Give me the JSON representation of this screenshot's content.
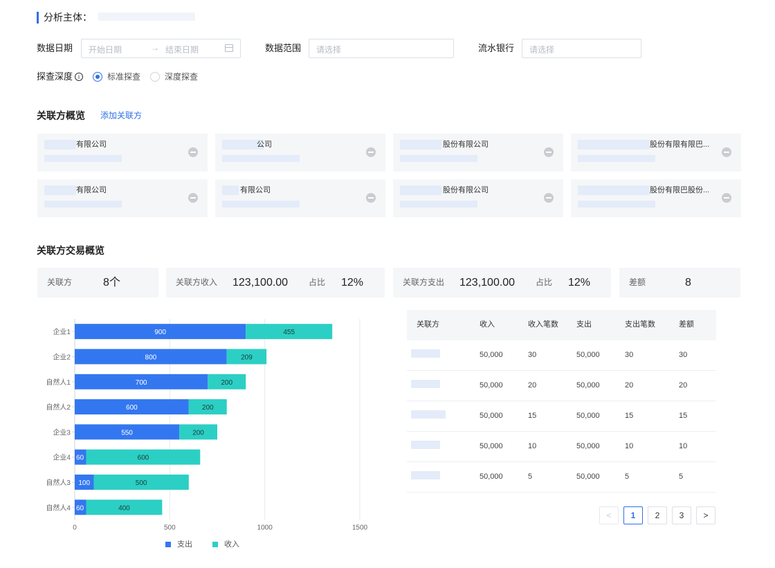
{
  "header": {
    "title": "分析主体："
  },
  "filters": {
    "date_label": "数据日期",
    "start_placeholder": "开始日期",
    "end_placeholder": "结束日期",
    "range_label": "数据范围",
    "range_placeholder": "请选择",
    "bank_label": "流水银行",
    "bank_placeholder": "请选择",
    "depth_label": "探查深度",
    "depth_options": [
      "标准探查",
      "深度探查"
    ],
    "depth_selected": "标准探查"
  },
  "related_overview": {
    "title": "关联方概览",
    "add_link": "添加关联方",
    "cards": [
      {
        "name": "有限公司"
      },
      {
        "name": "公司"
      },
      {
        "name": "股份有限公司"
      },
      {
        "name": "股份有限有限巴..."
      },
      {
        "name": "有限公司"
      },
      {
        "name": "有限公司"
      },
      {
        "name": "股份有限公司"
      },
      {
        "name": "股份有限巴股份..."
      }
    ]
  },
  "transactions": {
    "title": "关联方交易概览",
    "summary": {
      "count_label": "关联方",
      "count_value": "8个",
      "income_label": "关联方收入",
      "income_value": "123,100.00",
      "income_ratio_label": "占比",
      "income_ratio_value": "12%",
      "expense_label": "关联方支出",
      "expense_value": "123,100.00",
      "expense_ratio_label": "占比",
      "expense_ratio_value": "12%",
      "diff_label": "差额",
      "diff_value": "8"
    }
  },
  "colors": {
    "accent": "#2f6fe8",
    "expense": "#3377f0",
    "income": "#2ccfc4"
  },
  "chart_data": {
    "type": "bar",
    "orientation": "horizontal",
    "stacked": true,
    "categories": [
      "企业1",
      "企业2",
      "自然人1",
      "自然人2",
      "企业3",
      "企业4",
      "自然人3",
      "自然人4"
    ],
    "series": [
      {
        "name": "支出",
        "color": "#3377f0",
        "values": [
          900,
          800,
          700,
          600,
          550,
          60,
          100,
          60
        ]
      },
      {
        "name": "收入",
        "color": "#2ccfc4",
        "values": [
          455,
          209,
          200,
          200,
          200,
          600,
          500,
          400
        ]
      }
    ],
    "xlim": [
      0,
      1500
    ],
    "xticks": [
      "0",
      "500",
      "1000",
      "1500"
    ],
    "grid": "vertical",
    "legend": "bottom"
  },
  "table": {
    "columns": [
      "关联方",
      "收入",
      "收入笔数",
      "支出",
      "支出笔数",
      "差额"
    ],
    "rows": [
      {
        "income": "50,000",
        "income_count": "30",
        "expense": "50,000",
        "expense_count": "30",
        "diff": "30"
      },
      {
        "income": "50,000",
        "income_count": "20",
        "expense": "50,000",
        "expense_count": "20",
        "diff": "20"
      },
      {
        "income": "50,000",
        "income_count": "15",
        "expense": "50,000",
        "expense_count": "15",
        "diff": "15"
      },
      {
        "income": "50,000",
        "income_count": "10",
        "expense": "50,000",
        "expense_count": "10",
        "diff": "10"
      },
      {
        "income": "50,000",
        "income_count": "5",
        "expense": "50,000",
        "expense_count": "5",
        "diff": "5"
      }
    ]
  },
  "pagination": {
    "prev": "<",
    "pages": [
      "1",
      "2",
      "3"
    ],
    "current": "1",
    "next": ">"
  }
}
